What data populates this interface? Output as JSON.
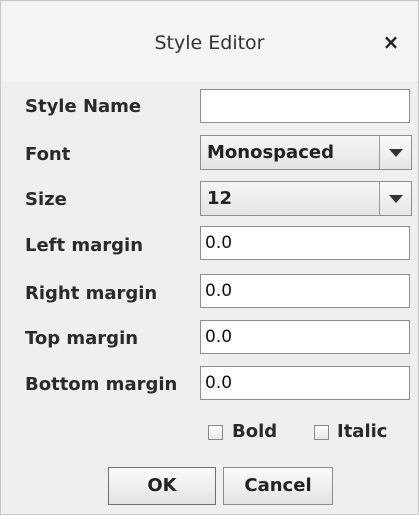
{
  "dialog": {
    "title": "Style Editor",
    "close_glyph": "×"
  },
  "form": {
    "style_name": {
      "label": "Style Name",
      "value": ""
    },
    "font": {
      "label": "Font",
      "selected": "Monospaced"
    },
    "size": {
      "label": "Size",
      "selected": "12"
    },
    "left_margin": {
      "label": "Left margin",
      "value": "0.0"
    },
    "right_margin": {
      "label": "Right margin",
      "value": "0.0"
    },
    "top_margin": {
      "label": "Top margin",
      "value": "0.0"
    },
    "bottom_margin": {
      "label": "Bottom margin",
      "value": "0.0"
    },
    "bold": {
      "label": "Bold",
      "checked": false
    },
    "italic": {
      "label": "Italic",
      "checked": false
    }
  },
  "buttons": {
    "ok": "OK",
    "cancel": "Cancel"
  },
  "icons": {
    "close": "close-icon",
    "dropdown": "chevron-down-icon"
  }
}
